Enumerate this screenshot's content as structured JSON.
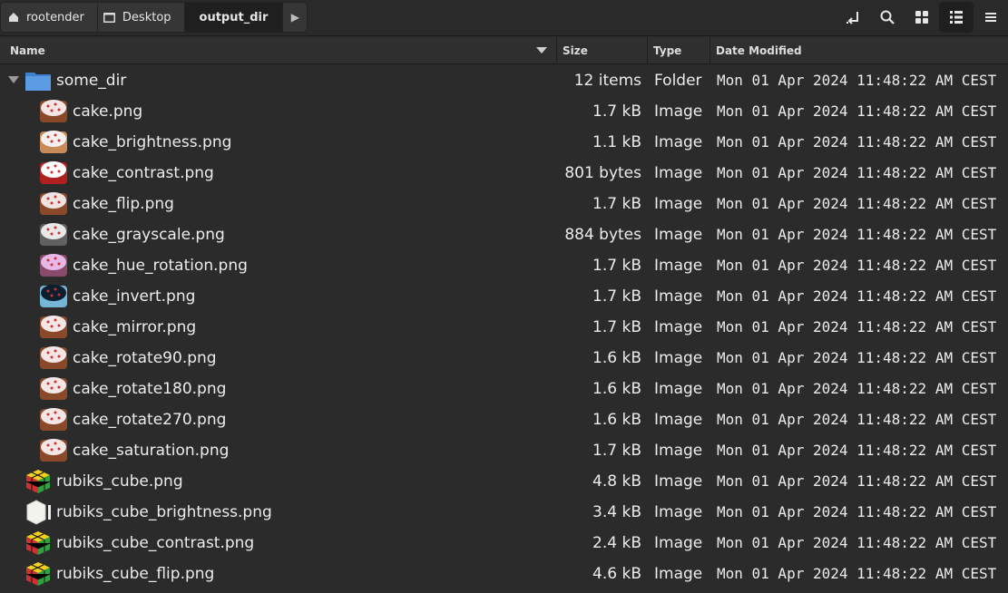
{
  "toolbar": {
    "crumbs": [
      {
        "label": "rootender",
        "icon": "home-icon"
      },
      {
        "label": "Desktop",
        "icon": "folder-icon"
      },
      {
        "label": "output_dir",
        "icon": ""
      }
    ],
    "buttons": [
      "open-terminal-icon",
      "search-icon",
      "grid-view-icon",
      "list-view-icon",
      "menu-icon"
    ]
  },
  "columns": {
    "name": "Name",
    "size": "Size",
    "type": "Type",
    "date": "Date Modified"
  },
  "files": [
    {
      "name": "some_dir",
      "size": "12 items",
      "type": "Folder",
      "date": "Mon 01 Apr 2024 11:48:22 AM CEST",
      "kind": "folder",
      "level": 0
    },
    {
      "name": "cake.png",
      "size": "1.7 kB",
      "type": "Image",
      "date": "Mon 01 Apr 2024 11:48:22 AM CEST",
      "kind": "cake",
      "level": 1
    },
    {
      "name": "cake_brightness.png",
      "size": "1.1 kB",
      "type": "Image",
      "date": "Mon 01 Apr 2024 11:48:22 AM CEST",
      "kind": "cake",
      "level": 1
    },
    {
      "name": "cake_contrast.png",
      "size": "801 bytes",
      "type": "Image",
      "date": "Mon 01 Apr 2024 11:48:22 AM CEST",
      "kind": "cake",
      "level": 1
    },
    {
      "name": "cake_flip.png",
      "size": "1.7 kB",
      "type": "Image",
      "date": "Mon 01 Apr 2024 11:48:22 AM CEST",
      "kind": "cake",
      "level": 1
    },
    {
      "name": "cake_grayscale.png",
      "size": "884 bytes",
      "type": "Image",
      "date": "Mon 01 Apr 2024 11:48:22 AM CEST",
      "kind": "cake",
      "level": 1
    },
    {
      "name": "cake_hue_rotation.png",
      "size": "1.7 kB",
      "type": "Image",
      "date": "Mon 01 Apr 2024 11:48:22 AM CEST",
      "kind": "cake",
      "level": 1
    },
    {
      "name": "cake_invert.png",
      "size": "1.7 kB",
      "type": "Image",
      "date": "Mon 01 Apr 2024 11:48:22 AM CEST",
      "kind": "cake",
      "level": 1
    },
    {
      "name": "cake_mirror.png",
      "size": "1.7 kB",
      "type": "Image",
      "date": "Mon 01 Apr 2024 11:48:22 AM CEST",
      "kind": "cake",
      "level": 1
    },
    {
      "name": "cake_rotate90.png",
      "size": "1.6 kB",
      "type": "Image",
      "date": "Mon 01 Apr 2024 11:48:22 AM CEST",
      "kind": "cake",
      "level": 1
    },
    {
      "name": "cake_rotate180.png",
      "size": "1.6 kB",
      "type": "Image",
      "date": "Mon 01 Apr 2024 11:48:22 AM CEST",
      "kind": "cake",
      "level": 1
    },
    {
      "name": "cake_rotate270.png",
      "size": "1.6 kB",
      "type": "Image",
      "date": "Mon 01 Apr 2024 11:48:22 AM CEST",
      "kind": "cake",
      "level": 1
    },
    {
      "name": "cake_saturation.png",
      "size": "1.7 kB",
      "type": "Image",
      "date": "Mon 01 Apr 2024 11:48:22 AM CEST",
      "kind": "cake",
      "level": 1
    },
    {
      "name": "rubiks_cube.png",
      "size": "4.8 kB",
      "type": "Image",
      "date": "Mon 01 Apr 2024 11:48:22 AM CEST",
      "kind": "cube",
      "level": 0
    },
    {
      "name": "rubiks_cube_brightness.png",
      "size": "3.4 kB",
      "type": "Image",
      "date": "Mon 01 Apr 2024 11:48:22 AM CEST",
      "kind": "cube-light",
      "level": 0
    },
    {
      "name": "rubiks_cube_contrast.png",
      "size": "2.4 kB",
      "type": "Image",
      "date": "Mon 01 Apr 2024 11:48:22 AM CEST",
      "kind": "cube",
      "level": 0
    },
    {
      "name": "rubiks_cube_flip.png",
      "size": "4.6 kB",
      "type": "Image",
      "date": "Mon 01 Apr 2024 11:48:22 AM CEST",
      "kind": "cube",
      "level": 0
    }
  ],
  "colors": {
    "background": "#2b2b2b",
    "header": "#2f2f2f",
    "text": "#ececec",
    "folder": "#4a8fd8"
  }
}
